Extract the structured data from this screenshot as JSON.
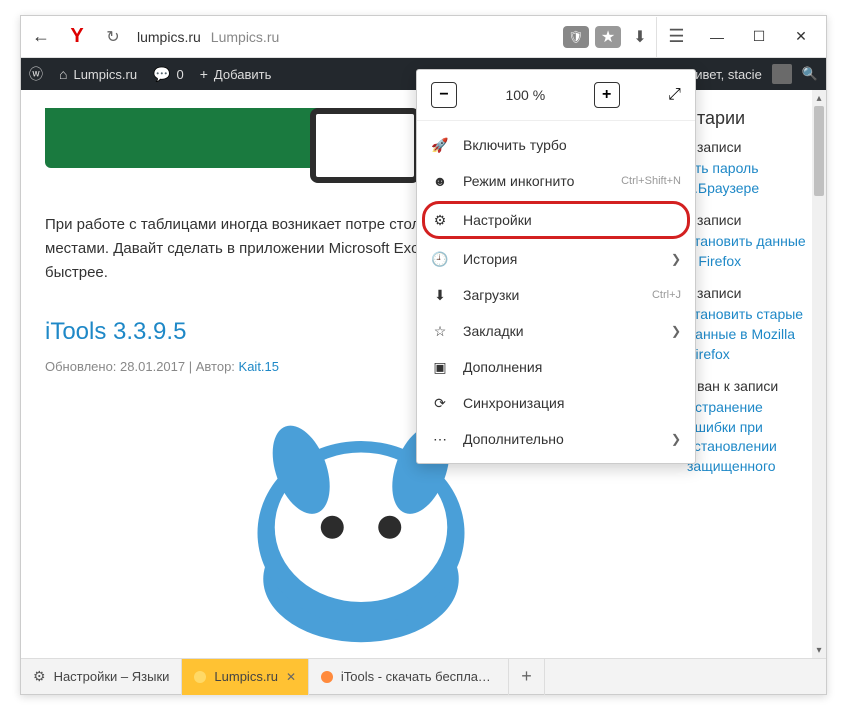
{
  "titlebar": {
    "domain": "lumpics.ru",
    "title": "Lumpics.ru"
  },
  "wpbar": {
    "site": "Lumpics.ru",
    "comments": "0",
    "add": "Добавить",
    "greeting": "ивет, stacie"
  },
  "article": {
    "paragraph": "При работе с таблицами иногда возникает потре столбцы, расположенные в ней, местами. Давайт сделать в приложении Microsoft Excel без потери как можно проще и быстрее.",
    "title": "iTools 3.3.9.5",
    "updated_label": "Обновлено:",
    "updated": "28.01.2017",
    "author_label": "Автор:",
    "author": "Kait.15"
  },
  "sidebar": {
    "heading1": "нтарии",
    "block1_text": "к записи",
    "block1_link": "ить пароль с.Браузере",
    "block2_text": "к записи",
    "block2_link": "становить данные в Firefox",
    "block3_text": "к записи",
    "block3_link": "становить старые данные в Mozilla Firefox",
    "block4_text": "Иван к записи",
    "block4_link": "Устранение ошибки при установлении защищенного"
  },
  "menu": {
    "zoom": "100 %",
    "turbo": "Включить турбо",
    "incognito": "Режим инкогнито",
    "incognito_sc": "Ctrl+Shift+N",
    "settings": "Настройки",
    "history": "История",
    "downloads": "Загрузки",
    "downloads_sc": "Ctrl+J",
    "bookmarks": "Закладки",
    "addons": "Дополнения",
    "sync": "Синхронизация",
    "more": "Дополнительно"
  },
  "tabs": {
    "t1": "Настройки – Языки",
    "t2": "Lumpics.ru",
    "t3": "iTools - скачать бесплатно"
  }
}
